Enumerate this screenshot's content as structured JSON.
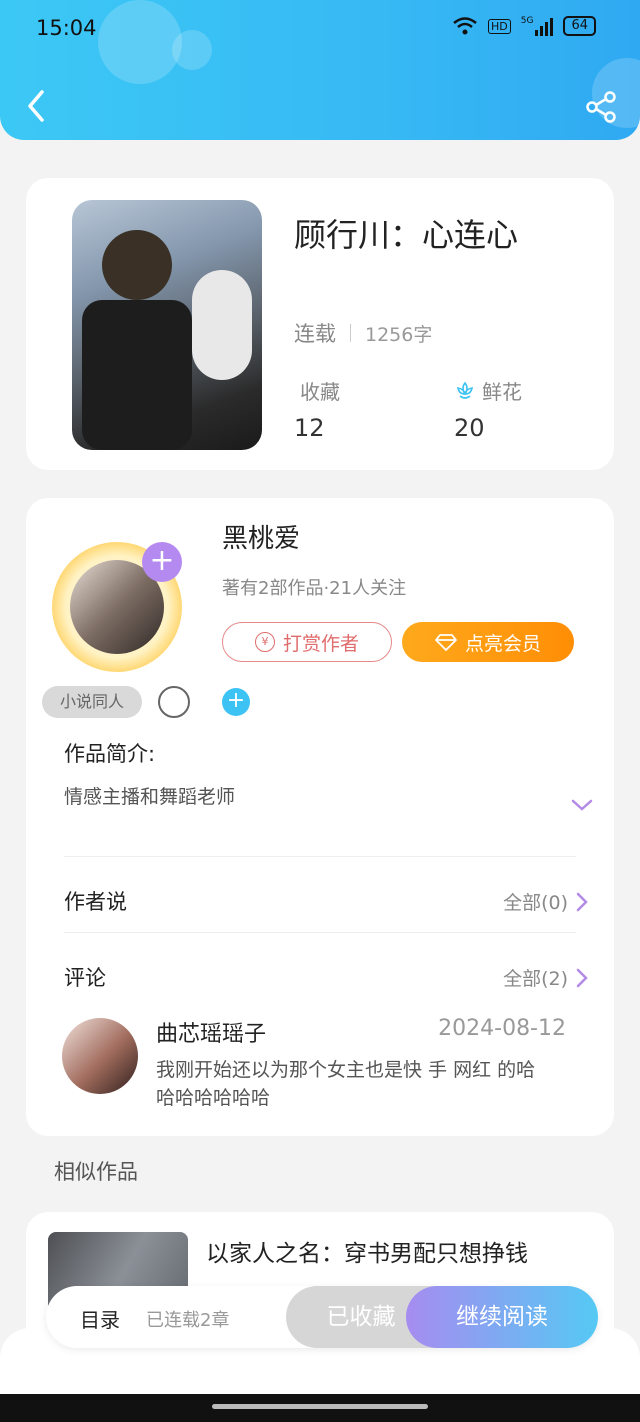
{
  "status_bar": {
    "time": "15:04",
    "network": "5G",
    "battery": "64"
  },
  "book": {
    "title": "顾行川：心连心",
    "status": "连载",
    "word_count": "1256字",
    "collect_label": "收藏",
    "collect_count": "12",
    "flower_label": "鲜花",
    "flower_count": "20"
  },
  "author": {
    "name": "黑桃爱",
    "sub": "著有2部作品·21人关注",
    "tip_label": "打赏作者",
    "vip_label": "点亮会员",
    "tag": "小说同人"
  },
  "intro": {
    "label": "作品简介:",
    "text": "情感主播和舞蹈老师"
  },
  "author_says": {
    "label": "作者说",
    "all": "全部(0)"
  },
  "comments": {
    "label": "评论",
    "all": "全部(2)",
    "item": {
      "user": "曲芯瑶瑶子",
      "date": "2024-08-12",
      "text": "我刚开始还以为那个女主也是快  手   网红   的哈哈哈哈哈哈哈"
    }
  },
  "similar": {
    "label": "相似作品",
    "item_title": "以家人之名：穿书男配只想挣钱"
  },
  "bottom_bar": {
    "toc_label": "目录",
    "toc_sub": "已连载2章",
    "collected_label": "已收藏",
    "read_label": "继续阅读"
  },
  "colors": {
    "header": "#3cc8f5",
    "vip": "#ff9a10",
    "accent_purple": "#b489f0",
    "tip": "#e06d6d"
  }
}
